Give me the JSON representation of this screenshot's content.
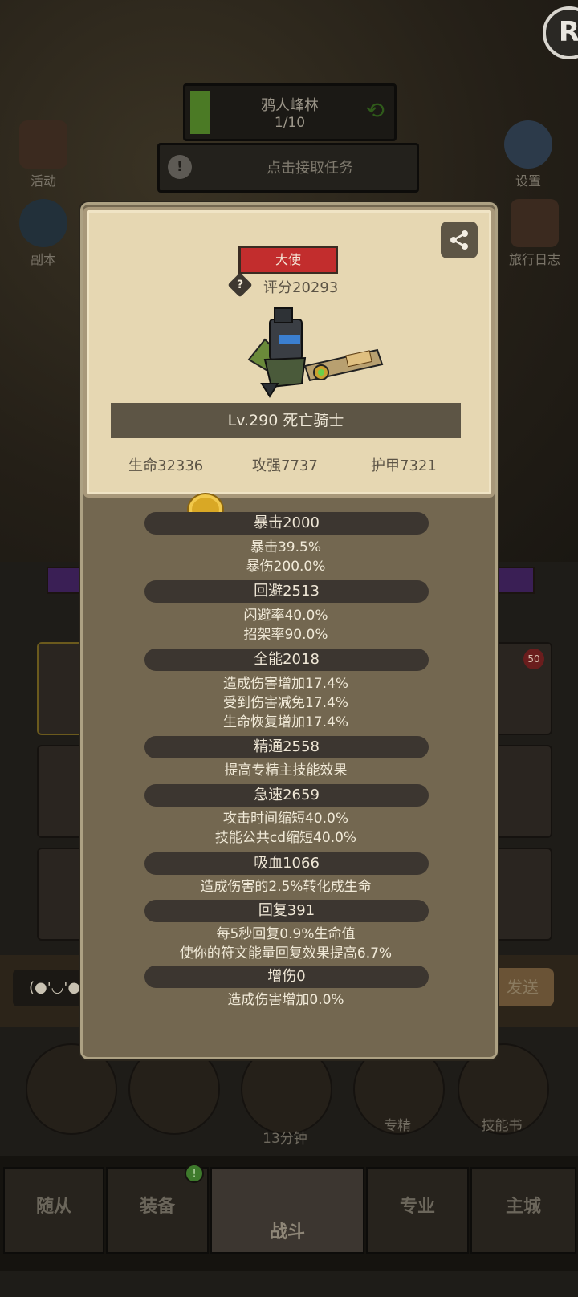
{
  "hud": {
    "zone_name": "鸦人峰林",
    "zone_progress": "1/10",
    "task_text": "点击接取任务",
    "left_icons": [
      "活动",
      "副本"
    ],
    "right_icons": [
      "设置",
      "旅行日志"
    ]
  },
  "modal": {
    "rank": "大使",
    "score": "评分20293",
    "hero_name": "Lv.290 死亡骑士",
    "stats": [
      "生命32336",
      "攻强7737",
      "护甲7321"
    ],
    "sections": [
      {
        "header": "暴击2000",
        "lines": [
          "暴击39.5%",
          "暴伤200.0%"
        ]
      },
      {
        "header": "回避2513",
        "lines": [
          "闪避率40.0%",
          "招架率90.0%"
        ]
      },
      {
        "header": "全能2018",
        "lines": [
          "造成伤害增加17.4%",
          "受到伤害减免17.4%",
          "生命恢复增加17.4%"
        ]
      },
      {
        "header": "精通2558",
        "lines": [
          "提高专精主技能效果"
        ]
      },
      {
        "header": "急速2659",
        "lines": [
          "攻击时间缩短40.0%",
          "技能公共cd缩短40.0%"
        ]
      },
      {
        "header": "吸血1066",
        "lines": [
          "造成伤害的2.5%转化成生命"
        ]
      },
      {
        "header": "回复391",
        "lines": [
          "每5秒回复0.9%生命值",
          "使你的符文能量回复效果提高6.7%"
        ]
      },
      {
        "header": "增伤0",
        "lines": [
          "造成伤害增加0.0%"
        ]
      }
    ]
  },
  "background": {
    "chat_face": "(●'◡'●",
    "send_label": "发送",
    "timer": "13分钟",
    "actions": [
      "专精",
      "技能书"
    ],
    "slot_badge": "50"
  },
  "nav": {
    "tabs": [
      "随从",
      "装备",
      "战斗",
      "专业",
      "主城"
    ],
    "active": "战斗"
  },
  "colors": {
    "panel_bg": "#736750",
    "card_bg": "#e6d7b2",
    "rank_red": "#c22d2d",
    "progress_green": "#4b7a25"
  }
}
